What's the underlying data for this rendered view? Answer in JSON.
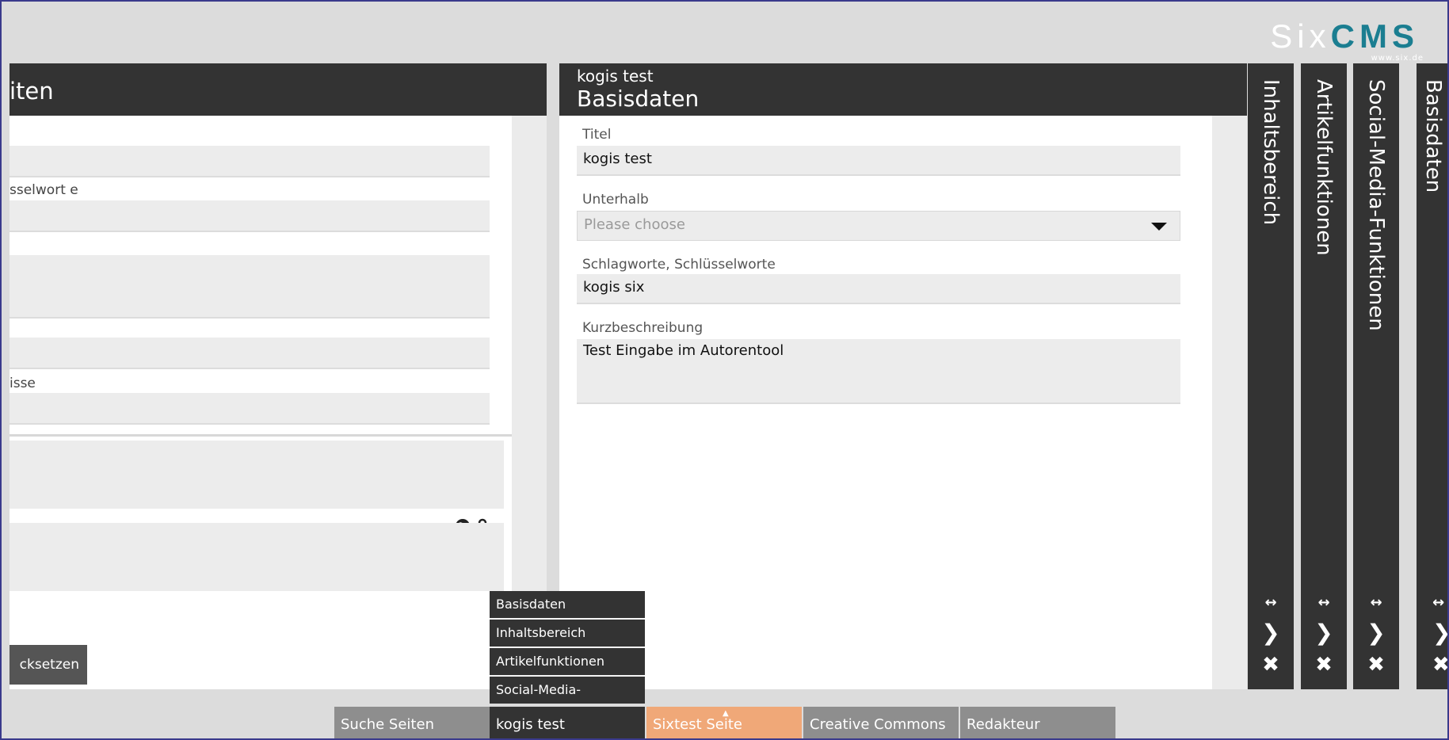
{
  "brand": {
    "six": "Six",
    "cms": "CMS",
    "url": "www.six.de"
  },
  "left_panel": {
    "title": "iten",
    "labels": {
      "keywords": "sselwort e",
      "links": "isse"
    },
    "reset_label": "cksetzen"
  },
  "main_panel": {
    "subtitle": "kogis test",
    "title": "Basisdaten",
    "fields": {
      "titel_label": "Titel",
      "titel_value": "kogis test",
      "unterhalb_label": "Unterhalb",
      "unterhalb_placeholder": "Please choose",
      "schlagworte_label": "Schlagworte, Schlüsselworte",
      "schlagworte_value": "kogis six",
      "kurz_label": "Kurzbeschreibung",
      "kurz_value": "Test Eingabe im Autorentool"
    }
  },
  "side_panels": [
    {
      "label": "Inhaltsbereich"
    },
    {
      "label": "Artikelfunktionen"
    },
    {
      "label": "Social-Media-Funktionen"
    },
    {
      "label": "Basisdaten"
    }
  ],
  "side_controls": {
    "resize": "↔",
    "next": "❯",
    "close": "✖"
  },
  "popup_menu": [
    "Basisdaten",
    "Inhaltsbereich",
    "Artikelfunktionen",
    "Social-Media-"
  ],
  "tabs": [
    {
      "label": "Suche Seiten"
    },
    {
      "label": "kogis test"
    },
    {
      "label": "Sixtest Seite"
    },
    {
      "label": "Creative Commons"
    },
    {
      "label": "Redakteur"
    }
  ],
  "colors": {
    "header": "#333333",
    "accent": "#1b7e91",
    "active_tab": "#f0a878"
  }
}
